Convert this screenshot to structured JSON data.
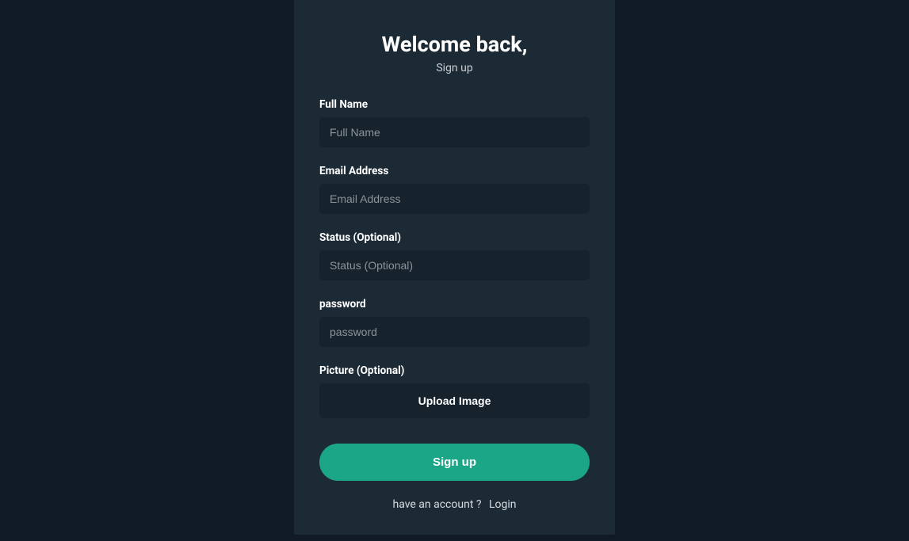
{
  "header": {
    "title": "Welcome back,",
    "subtitle": "Sign up"
  },
  "fields": {
    "fullname": {
      "label": "Full Name",
      "placeholder": "Full Name",
      "value": ""
    },
    "email": {
      "label": "Email Address",
      "placeholder": "Email Address",
      "value": ""
    },
    "status": {
      "label": "Status (Optional)",
      "placeholder": "Status (Optional)",
      "value": ""
    },
    "password": {
      "label": "password",
      "placeholder": "password",
      "value": ""
    },
    "picture": {
      "label": "Picture (Optional)",
      "button": "Upload Image"
    }
  },
  "submit": {
    "label": "Sign up"
  },
  "footer": {
    "text": "have an account ?",
    "link": "Login"
  }
}
